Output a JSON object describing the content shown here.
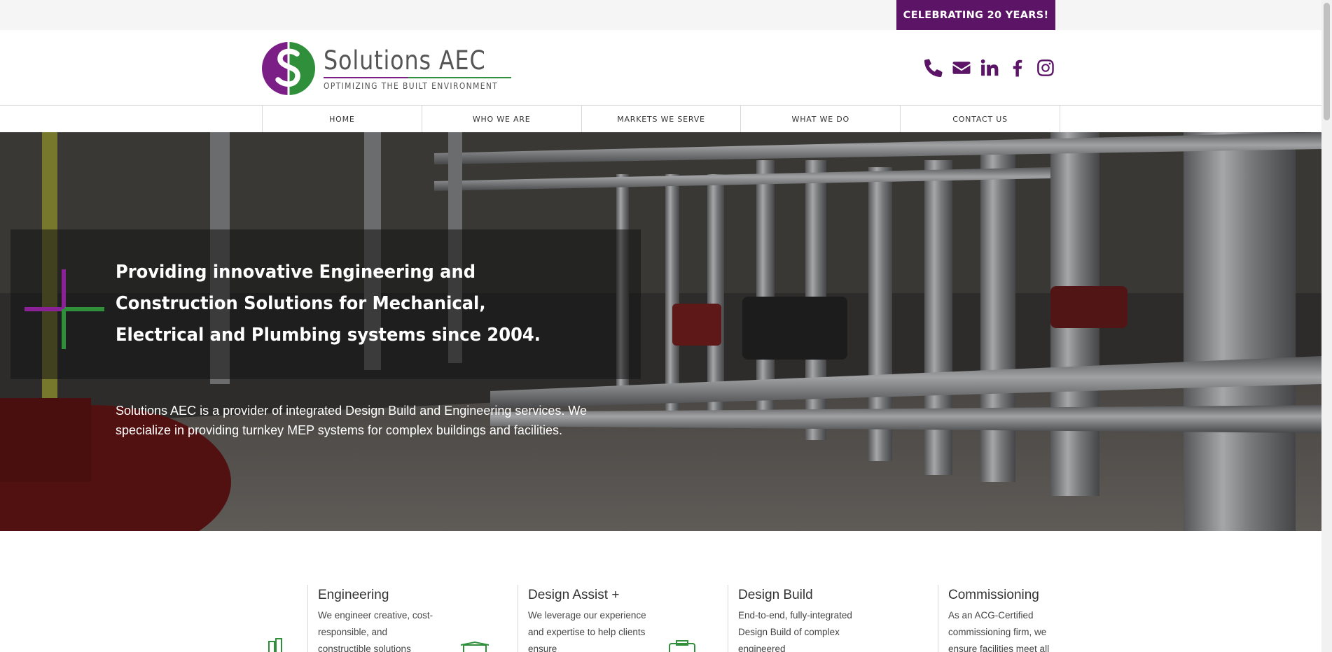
{
  "topbar": {
    "celebrate_label": "CELEBRATING 20 YEARS!"
  },
  "header": {
    "logo_name": "Solutions AEC",
    "logo_tagline": "OPTIMIZING THE BUILT ENVIRONMENT",
    "social_icons": [
      "phone-icon",
      "email-icon",
      "linkedin-icon",
      "facebook-icon",
      "instagram-icon"
    ]
  },
  "nav": {
    "items": [
      "HOME",
      "WHO WE ARE",
      "MARKETS WE SERVE",
      "WHAT WE DO",
      "CONTACT US"
    ]
  },
  "hero": {
    "title": "Providing innovative Engineering and Construction Solutions for Mechanical, Electrical and Plumbing systems since 2004.",
    "description": "Solutions AEC is a provider of integrated Design Build and Engineering services. We specialize in providing turnkey MEP systems for complex buildings and facilities."
  },
  "services": [
    {
      "title": "Engineering",
      "text": "We engineer creative, cost-responsible, and constructible solutions"
    },
    {
      "title": "Design Assist +",
      "text": "We leverage our experience and expertise to help clients ensure"
    },
    {
      "title": "Design Build",
      "text": "End-to-end, fully-integrated Design Build of complex engineered"
    },
    {
      "title": "Commissioning",
      "text": "As an ACG-Certified commissioning firm, we ensure facilities meet all"
    }
  ],
  "colors": {
    "brand_purple": "#5b1466",
    "logo_purple": "#7b1f86",
    "logo_green": "#2f8f3a"
  }
}
